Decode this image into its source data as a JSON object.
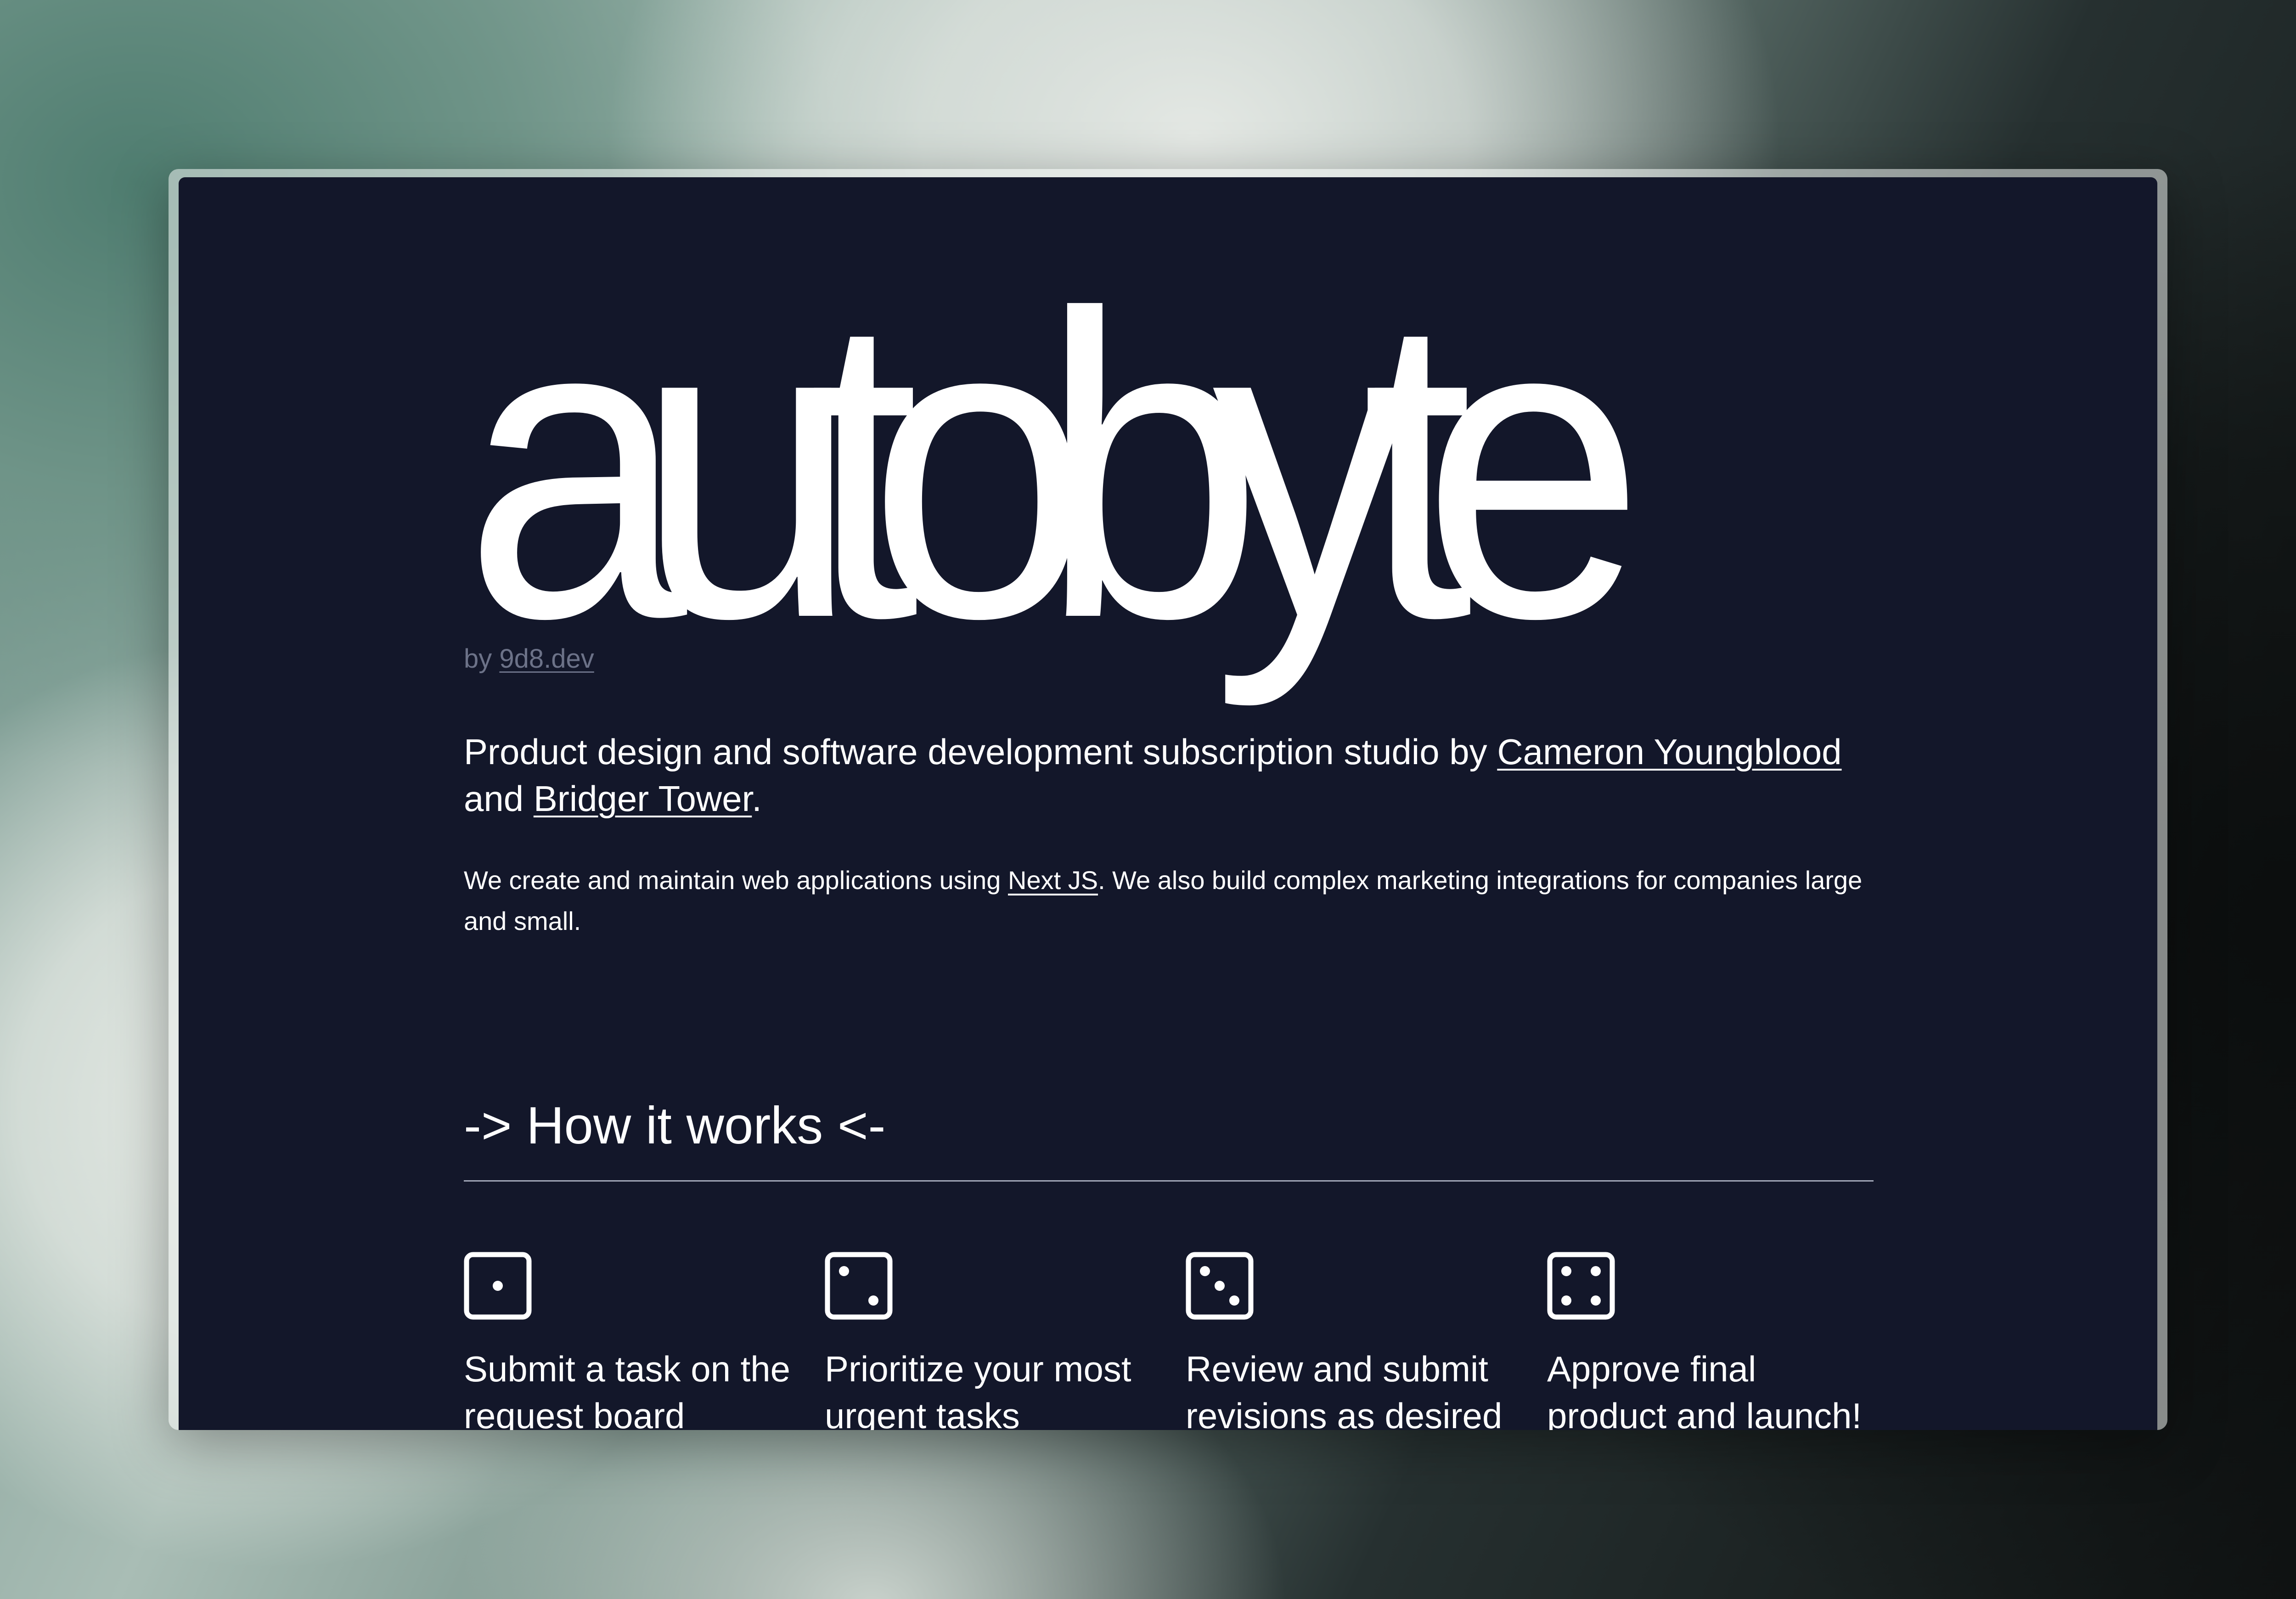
{
  "brand": {
    "logo_text": "autobyte",
    "byline_prefix": "by",
    "byline_link": "9d8.dev"
  },
  "intro": {
    "lead_text_1": "Product design and software development subscription studio by ",
    "founder_1": "Cameron Youngblood",
    "lead_text_2": " and ",
    "founder_2": "Bridger Tower",
    "lead_text_3": ".",
    "body_text_1": "We create and maintain web applications using ",
    "body_link": "Next JS",
    "body_text_2": ". We also build complex marketing integrations for companies large and small."
  },
  "how_it_works": {
    "title": "-> How it works <-",
    "steps": [
      {
        "icon": "die-one-icon",
        "label": "Submit a task on the request board"
      },
      {
        "icon": "die-two-icon",
        "label": "Prioritize your most urgent tasks"
      },
      {
        "icon": "die-three-icon",
        "label": "Review and submit revisions as desired"
      },
      {
        "icon": "die-four-icon",
        "label": "Approve final product and launch!"
      }
    ]
  },
  "colors": {
    "page_background": "#13172a",
    "text": "#ffffff",
    "muted_text": "#6c7288",
    "divider": "#a2a7b7"
  }
}
